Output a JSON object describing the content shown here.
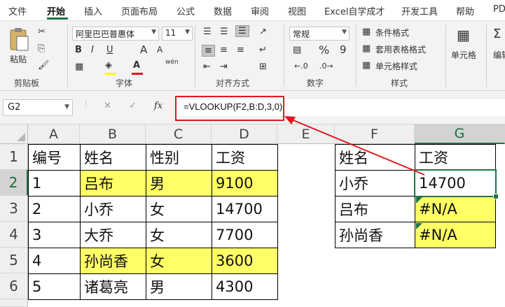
{
  "menu": {
    "tabs": [
      "文件",
      "开始",
      "插入",
      "页面布局",
      "公式",
      "数据",
      "审阅",
      "视图",
      "Excel自学成才",
      "开发工具",
      "帮助",
      "PD"
    ],
    "active_tab": "开始"
  },
  "ribbon": {
    "clipboard": {
      "paste_label": "粘贴",
      "group_label": "剪贴板"
    },
    "font": {
      "font_name": "阿里巴巴普惠体",
      "font_size": "11",
      "bold": "B",
      "italic": "I",
      "underline": "U",
      "grow": "A",
      "shrink": "A",
      "phonetic": "wén",
      "group_label": "字体"
    },
    "alignment": {
      "group_label": "对齐方式"
    },
    "number": {
      "format": "常规",
      "percent": "%",
      "comma": "9",
      "group_label": "数字"
    },
    "styles": {
      "conditional": "条件格式",
      "table": "套用表格格式",
      "cell_styles": "单元格样式",
      "group_label": "样式"
    },
    "cells": {
      "label": "单元格"
    },
    "editing": {
      "label": "编辑"
    }
  },
  "formula_bar": {
    "name_box": "G2",
    "cancel": "✕",
    "enter": "✓",
    "fx": "fx",
    "formula": "=VLOOKUP(F2,B:D,3,0)"
  },
  "sheet": {
    "columns": [
      "A",
      "B",
      "C",
      "D",
      "E",
      "F",
      "G"
    ],
    "active_column": "G",
    "rows": [
      "1",
      "2",
      "3",
      "4",
      "5",
      "6"
    ],
    "active_row": "2",
    "left_table": [
      [
        "编号",
        "姓名",
        "性别",
        "工资"
      ],
      [
        "1",
        "吕布",
        "男",
        "9100"
      ],
      [
        "2",
        "小乔",
        "女",
        "14700"
      ],
      [
        "3",
        "大乔",
        "女",
        "7700"
      ],
      [
        "4",
        "孙尚香",
        "女",
        "3600"
      ],
      [
        "5",
        "诸葛亮",
        "男",
        "4300"
      ]
    ],
    "right_table": [
      [
        "姓名",
        "工资"
      ],
      [
        "小乔",
        "14700"
      ],
      [
        "吕布",
        "#N/A"
      ],
      [
        "孙尚香",
        "#N/A"
      ]
    ],
    "highlight_color": "#ffff66",
    "accent_color": "#217346",
    "annotation_color": "#e0191f"
  }
}
